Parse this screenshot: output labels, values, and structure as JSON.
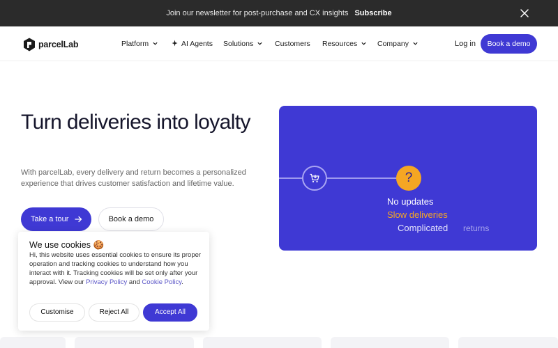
{
  "announcement": {
    "message": "Join our newsletter for post-purchase and CX insights",
    "cta": "Subscribe",
    "close_icon": "close-icon"
  },
  "nav": {
    "logo_text": "parcelLab",
    "items": [
      {
        "label": "Platform",
        "icon": "chevron-down-icon"
      },
      {
        "label": "AI Agents",
        "icon": "sparkle-icon"
      },
      {
        "label": "Solutions",
        "icon": "chevron-down-icon"
      },
      {
        "label": "Customers"
      },
      {
        "label": "Resources",
        "icon": "chevron-down-icon"
      },
      {
        "label": "Company",
        "icon": "chevron-down-icon"
      }
    ],
    "login": "Log in",
    "book_demo": "Book a demo"
  },
  "hero": {
    "title": "Turn deliveries into loyalty",
    "subtitle": "With parcelLab, every delivery and return becomes a personalized experience that drives customer satisfaction and lifetime value.",
    "primary_cta": "Take a tour",
    "secondary_cta": "Book a demo"
  },
  "illustration": {
    "question_mark": "?",
    "words": {
      "no_updates": "No updates",
      "slow_deliveries": "Slow deliveries",
      "complicated": "Complicated",
      "returns": "returns"
    },
    "colors": {
      "background": "#3f39d4",
      "accent": "#f5a623"
    }
  },
  "cookie": {
    "title": "We use cookies",
    "emoji": "🍪",
    "body_main": "Hi, this website uses essential cookies to ensure its proper operation and tracking cookies to understand how you interact with it. Tracking cookies will be set only after your approval. View our",
    "privacy_link": "Privacy Policy",
    "and": "and",
    "cookie_link": "Cookie Policy",
    "period": ".",
    "customise": "Customise",
    "reject": "Reject All",
    "accept": "Accept All"
  },
  "theme": {
    "brand": "#3f39d4",
    "topbar": "#2b2b2b"
  }
}
